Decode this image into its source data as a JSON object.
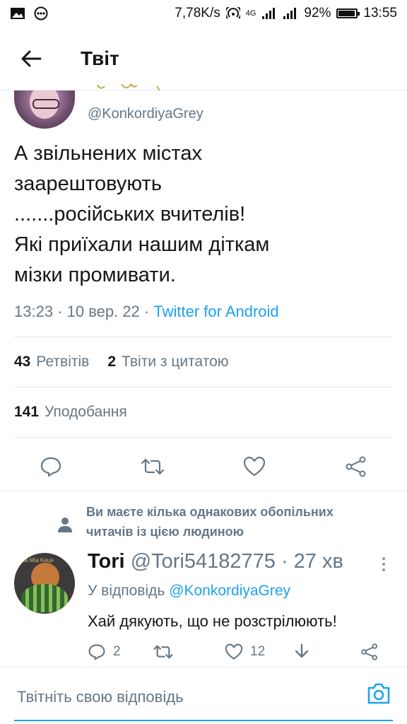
{
  "status_bar": {
    "net_speed": "7,78K/s",
    "network_label": "4G",
    "battery": "92%",
    "battery_level": 0.92,
    "time": "13:55"
  },
  "app_bar": {
    "title": "Твіт",
    "back_icon": "arrow-left-icon"
  },
  "tweet": {
    "handle": "@KonkordiyaGrey",
    "text_lines": [
      "А звільнених містах",
      "заарештовують",
      ".......російських вчителів!",
      "Які приїхали нашим діткам",
      "мізки промивати."
    ],
    "meta": {
      "time": "13:23 · 10 вер. 22 ·",
      "source": "Twitter for Android"
    },
    "stats": {
      "retweets_count": "43",
      "retweets_label": "Ретвітів",
      "quotes_count": "2",
      "quotes_label": "Твіти з цитатою",
      "likes_count": "141",
      "likes_label": "Уподобання"
    }
  },
  "mutual_notice": {
    "line1": "Ви маєте кілька однакових обопільних",
    "line2": "читачів із цією людиною"
  },
  "reply": {
    "name": "Tori",
    "handle": "@Tori54182775",
    "time": "· 27 хв",
    "reply_to_label": "У відповідь",
    "reply_to_handle": "@KonkordiyaGrey",
    "text": "Хай дякують, що не розстрілюють!",
    "avatar_text": "Ла Mia Kиця",
    "replies_count": "2",
    "likes_count": "12"
  },
  "composer": {
    "placeholder": "Твітніть свою відповідь"
  },
  "colors": {
    "accent": "#1da1f2",
    "secondary_text": "#657786",
    "divider": "#e1e8ed"
  }
}
